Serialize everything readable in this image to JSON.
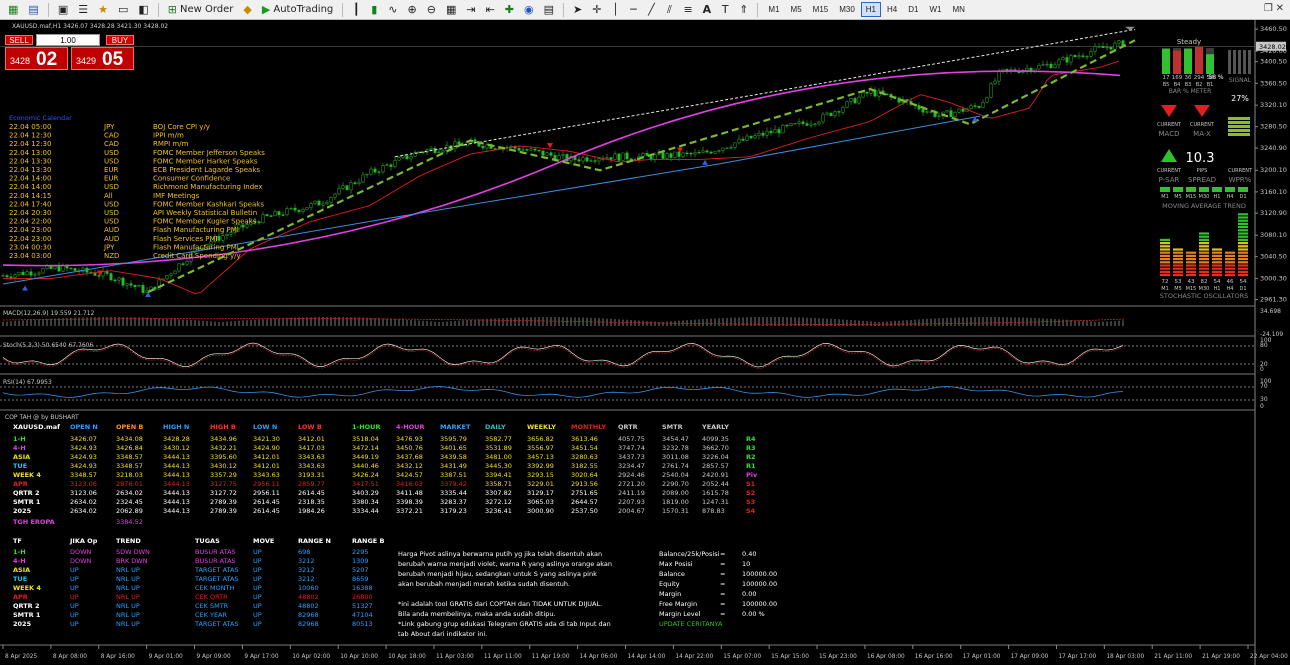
{
  "toolbar": {
    "new_order_label": "New Order",
    "autotrading_label": "AutoTrading",
    "timeframes": [
      "M1",
      "M5",
      "M15",
      "M30",
      "H1",
      "H4",
      "D1",
      "W1",
      "MN"
    ],
    "active_timeframe": "H1"
  },
  "chart_header": {
    "symbol_line": "XAUUSD.maf,H1  3426.07 3428.28 3421.30 3428.02"
  },
  "trade_panel": {
    "sell_label": "SELL",
    "buy_label": "BUY",
    "lot_value": "1.00",
    "sell_price_small": "3428",
    "sell_price_big": "02",
    "buy_price_small": "3429",
    "buy_price_big": "05"
  },
  "news": {
    "heading": "Economic Calendar",
    "rows": [
      [
        "22.04 05:00",
        "JPY",
        "BOJ Core CPI y/y"
      ],
      [
        "22.04 12:30",
        "CAD",
        "IPPI m/m"
      ],
      [
        "22.04 12:30",
        "CAD",
        "RMPI m/m"
      ],
      [
        "22.04 13:00",
        "USD",
        "FOMC Member Jefferson Speaks"
      ],
      [
        "22.04 13:30",
        "USD",
        "FOMC Member Harker Speaks"
      ],
      [
        "22.04 13:30",
        "EUR",
        "ECB President Lagarde Speaks"
      ],
      [
        "22.04 14:00",
        "EUR",
        "Consumer Confidence"
      ],
      [
        "22.04 14:00",
        "USD",
        "Richmond Manufacturing Index"
      ],
      [
        "22.04 14:15",
        "All",
        "IMF Meetings"
      ],
      [
        "22.04 17:40",
        "USD",
        "FOMC Member Kashkari Speaks"
      ],
      [
        "22.04 20:30",
        "USD",
        "API Weekly Statistical Bulletin"
      ],
      [
        "22.04 22:00",
        "USD",
        "FOMC Member Kugler Speaks"
      ],
      [
        "22.04 23:00",
        "AUD",
        "Flash Manufacturing PMI"
      ],
      [
        "22.04 23:00",
        "AUD",
        "Flash Services PMI"
      ],
      [
        "23.04 00:30",
        "JPY",
        "Flash Manufacturing PMI"
      ],
      [
        "23.04 03:00",
        "NZD",
        "Credit Card Spending y/y"
      ]
    ]
  },
  "price_axis": [
    "3460.50",
    "3420.00",
    "3400.50",
    "3360.50",
    "3320.10",
    "3280.50",
    "3240.90",
    "3200.10",
    "3160.10",
    "3120.90",
    "3080.10",
    "3040.50",
    "3000.30",
    "2961.30"
  ],
  "current_price": "3428.02",
  "time_axis": [
    "8 Apr 2025",
    "8 Apr 08:00",
    "8 Apr 16:00",
    "9 Apr 01:00",
    "9 Apr 09:00",
    "9 Apr 17:00",
    "10 Apr 02:00",
    "10 Apr 10:00",
    "10 Apr 18:00",
    "11 Apr 03:00",
    "11 Apr 11:00",
    "11 Apr 19:00",
    "14 Apr 06:00",
    "14 Apr 14:00",
    "14 Apr 22:00",
    "15 Apr 07:00",
    "15 Apr 15:00",
    "15 Apr 23:00",
    "16 Apr 08:00",
    "16 Apr 16:00",
    "17 Apr 01:00",
    "17 Apr 09:00",
    "17 Apr 17:00",
    "18 Apr 03:00",
    "21 Apr 11:00",
    "21 Apr 19:00",
    "22 Apr 04:00"
  ],
  "indicators": {
    "macd_label": "MACD(12,26,9) 19.559 21.712",
    "macd_axis": [
      "34.698",
      "-24.109"
    ],
    "stoch_label": "Stoch(5,3,3) 50.6540 67.7606",
    "stoch_axis": [
      "100",
      "80",
      "20",
      "0"
    ],
    "rsi_label": "RSI(14) 67.9953",
    "rsi_axis": [
      "100",
      "70",
      "30",
      "0"
    ]
  },
  "side_panel": {
    "steady": "Steady",
    "bar_meter_label": "BAR % METER",
    "bar_values": [
      "17",
      "169",
      "36",
      "294",
      "58"
    ],
    "bar_tf": [
      "B5",
      "B4",
      "B3",
      "B2",
      "B1"
    ],
    "bar_pct": "58 %",
    "signal_label": "SIGNAL",
    "signal_pct": "27%",
    "current_label": "CURRENT",
    "macd_label": "MACD",
    "max_label": "MA-X",
    "pips_label": "PIPS",
    "spread_value": "10.3",
    "psar_label": "P-SAR",
    "spread_label": "SPREAD",
    "wpr_label": "WPR%",
    "ma_tf": [
      "M1",
      "M5",
      "M15",
      "M30",
      "H1",
      "H4",
      "D1"
    ],
    "ma_trend_label": "MOVING AVERAGE TREND",
    "stoch_vals": [
      "72",
      "53",
      "43",
      "82",
      "54",
      "46",
      "54"
    ],
    "stoch_tf": [
      "M1",
      "M5",
      "M15",
      "M30",
      "H1",
      "H4",
      "D1"
    ],
    "stoch_label": "STOCHASTIC OSCILLATORS"
  },
  "pivot": {
    "title": "COP TAH @ by BUSHART",
    "headers": [
      "XAUUSD.maf",
      "OPEN N",
      "OPEN B",
      "HIGH N",
      "HIGH B",
      "LOW N",
      "LOW B",
      "1-HOUR",
      "4-HOUR",
      "MARKET",
      "DAILY",
      "WEEKLY",
      "MONTHLY",
      "QRTR",
      "SMTR",
      "YEARLY"
    ],
    "rows": [
      [
        "1-H",
        "3426.07",
        "3434.08",
        "3428.28",
        "3434.96",
        "3421.30",
        "3412.01",
        "3518.04",
        "3476.93",
        "3595.79",
        "3582.77",
        "3656.82",
        "3613.46",
        "4057.75",
        "3454.47",
        "4099.35",
        "R4"
      ],
      [
        "4-H",
        "3424.93",
        "3426.84",
        "3430.12",
        "3432.21",
        "3424.90",
        "3417.03",
        "3472.14",
        "3450.76",
        "3401.65",
        "3531.89",
        "3556.97",
        "3451.54",
        "3747.74",
        "3232.78",
        "3662.70",
        "R3"
      ],
      [
        "ASIA",
        "3424.93",
        "3348.57",
        "3444.13",
        "3395.60",
        "3412.01",
        "3343.63",
        "3449.19",
        "3437.68",
        "3439.58",
        "3481.00",
        "3457.13",
        "3280.63",
        "3437.73",
        "3011.08",
        "3226.04",
        "R2"
      ],
      [
        "TUE",
        "3424.93",
        "3348.57",
        "3444.13",
        "3430.12",
        "3412.01",
        "3343.63",
        "3440.46",
        "3432.12",
        "3431.49",
        "3445.30",
        "3392.99",
        "3182.55",
        "3234.47",
        "2761.74",
        "2857.57",
        "R1"
      ],
      [
        "WEEK 4",
        "3348.57",
        "3218.03",
        "3444.13",
        "3357.29",
        "3343.63",
        "3193.31",
        "3426.24",
        "3424.57",
        "3387.51",
        "3394.41",
        "3293.15",
        "3020.64",
        "2924.46",
        "2540.04",
        "2420.91",
        "Piv"
      ],
      [
        "APR",
        "3123.06",
        "2876.01",
        "3444.13",
        "3127.75",
        "2956.11",
        "2859.77",
        "3417.51",
        "3416.03",
        "3379.42",
        "3358.71",
        "3229.01",
        "2913.56",
        "2721.20",
        "2290.70",
        "2052.44",
        "S1"
      ],
      [
        "QRTR 2",
        "3123.06",
        "2634.02",
        "3444.13",
        "3127.72",
        "2956.11",
        "2614.45",
        "3403.29",
        "3411.48",
        "3335.44",
        "3307.82",
        "3129.17",
        "2751.65",
        "2411.19",
        "2089.00",
        "1615.78",
        "S2"
      ],
      [
        "SMTR 1",
        "2634.02",
        "2324.45",
        "3444.13",
        "2789.39",
        "2614.45",
        "2318.35",
        "3380.34",
        "3398.39",
        "3283.37",
        "3272.12",
        "3065.03",
        "2644.57",
        "2207.93",
        "1819.00",
        "1247.31",
        "S3"
      ],
      [
        "2025",
        "2634.02",
        "2062.89",
        "3444.13",
        "2789.39",
        "2614.45",
        "1984.26",
        "3334.44",
        "3372.21",
        "3179.23",
        "3236.41",
        "3000.90",
        "2537.50",
        "2004.67",
        "1570.31",
        "878.83",
        "S4"
      ]
    ],
    "eropa_label": "TGH EROPA",
    "eropa_value": "3384.52",
    "trend_headers": [
      "TF",
      "JIKA Op",
      "TREND",
      "TUGAS",
      "MOVE",
      "RANGE N",
      "RANGE B"
    ],
    "trend_rows": [
      [
        "1-H",
        "DOWN",
        "SDW DWN",
        "BUSUR ATAS",
        "UP",
        "698",
        "2295"
      ],
      [
        "4-H",
        "DOWN",
        "BRK DWN",
        "BUSUR ATAS",
        "UP",
        "3212",
        "1309"
      ],
      [
        "ASIA",
        "UP",
        "NRL UP",
        "TARGET ATAS",
        "UP",
        "3212",
        "5207"
      ],
      [
        "TUE",
        "UP",
        "NRL UP",
        "TARGET ATAS",
        "UP",
        "3212",
        "8659"
      ],
      [
        "WEEK 4",
        "UP",
        "NRL UP",
        "CEK MONTH",
        "UP",
        "10060",
        "16388"
      ],
      [
        "APR",
        "UP",
        "NRL UP",
        "CEK QRTR",
        "UP",
        "48802",
        "26800"
      ],
      [
        "QRTR 2",
        "UP",
        "NRL UP",
        "CEK SMTR",
        "UP",
        "48802",
        "51327"
      ],
      [
        "SMTR 1",
        "UP",
        "NRL UP",
        "CEK YEAR",
        "UP",
        "82968",
        "47104"
      ],
      [
        "2025",
        "UP",
        "NRL UP",
        "TARGET ATAS",
        "UP",
        "82968",
        "80513"
      ]
    ],
    "notes": [
      "Harga Pivot aslinya berwarna putih yg jika telah disentuh akan",
      "berubah warna menjadi violet, warna R yang aslinya orange akan",
      "berubah menjadi hijau, sedangkan untuk S yang aslinya pink",
      "akan berubah menjadi merah ketika sudah disentuh.",
      "",
      "*ini adalah tool GRATIS dari COPTAH dan TIDAK UNTUK DIJUAL.",
      "  Bila anda membelinya, maka anda sudah ditipu.",
      "*Link gabung grup edukasi Telegram GRATIS ada di tab Input dan",
      "  tab About dari indikator ini."
    ],
    "account": [
      [
        "Balance/25k/Posisi",
        "=",
        "0.40"
      ],
      [
        "Max Posisi",
        "=",
        "10"
      ],
      [
        "Balance",
        "=",
        "100000.00"
      ],
      [
        "Equity",
        "=",
        "100000.00"
      ],
      [
        "Margin",
        "=",
        "0.00"
      ],
      [
        "Free Margin",
        "=",
        "100000.00"
      ],
      [
        "Margin Level",
        "=",
        "0.00 %"
      ]
    ],
    "update_label": "UPDATE CERITANYA"
  }
}
